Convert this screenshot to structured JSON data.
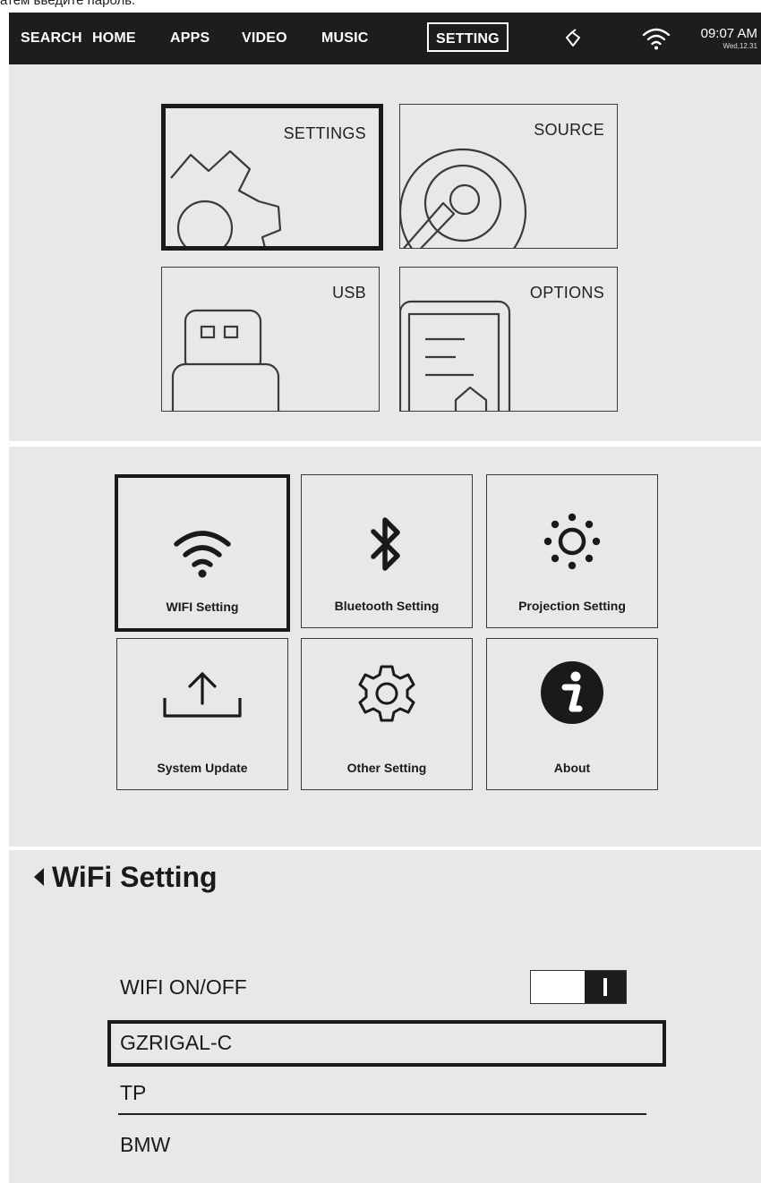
{
  "caption_fragment": "атем введите пароль.",
  "topbar": {
    "nav": [
      "SEARCH",
      "HOME",
      "APPS",
      "VIDEO",
      "MUSIC",
      "SETTING"
    ],
    "active": "SETTING",
    "time": "09:07 AM",
    "date": "Wed,12.31"
  },
  "home_tiles": {
    "settings": "SETTINGS",
    "source": "SOURCE",
    "usb": "USB",
    "options": "OPTIONS"
  },
  "setting_menu": {
    "wifi": "WIFI Setting",
    "bluetooth": "Bluetooth Setting",
    "projection": "Projection  Setting",
    "update": "System Update",
    "other": "Other Setting",
    "about": "About"
  },
  "wifi_page": {
    "title": "WiFi Setting",
    "toggle_label": "WIFI ON/OFF",
    "toggle_state": "on",
    "networks": [
      "GZRIGAL-C",
      "TP",
      "BMW"
    ]
  },
  "colors": {
    "topbar": "#1d1d1d",
    "panel": "#e7e8ea",
    "ink": "#1a1a1a"
  }
}
